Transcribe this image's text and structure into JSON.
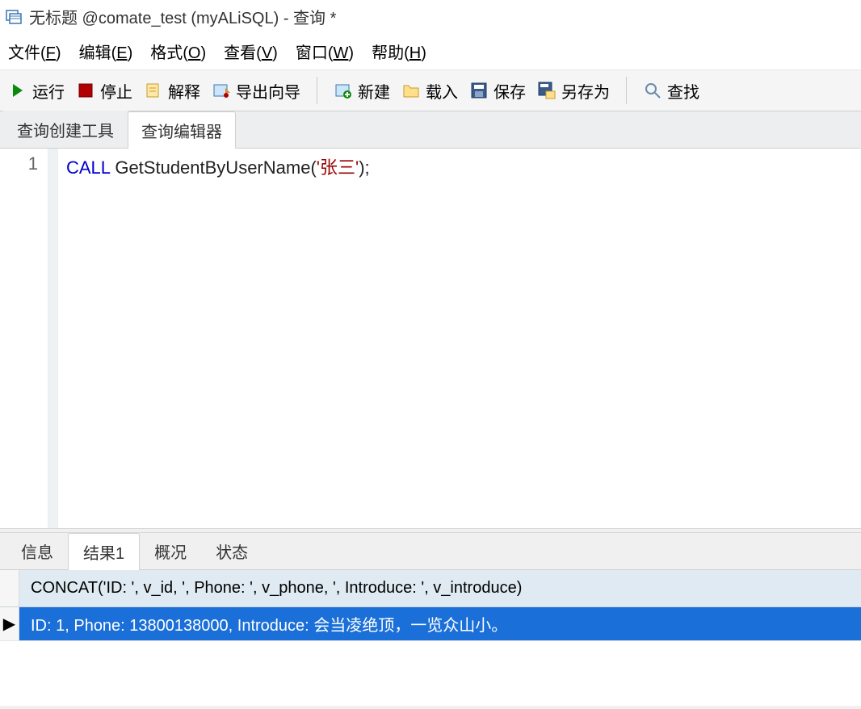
{
  "window": {
    "title": "无标题 @comate_test (myALiSQL) - 查询 *"
  },
  "menubar": {
    "file": "文件",
    "file_key": "F",
    "edit": "编辑",
    "edit_key": "E",
    "format": "格式",
    "format_key": "O",
    "view": "查看",
    "view_key": "V",
    "window": "窗口",
    "window_key": "W",
    "help": "帮助",
    "help_key": "H"
  },
  "toolbar": {
    "run": "运行",
    "stop": "停止",
    "explain": "解释",
    "export_wizard": "导出向导",
    "new": "新建",
    "load": "载入",
    "save": "保存",
    "save_as": "另存为",
    "find": "查找"
  },
  "editor_tabs": {
    "builder": "查询创建工具",
    "editor": "查询编辑器"
  },
  "code": {
    "line_no": "1",
    "keyword": "CALL",
    "func": " GetStudentByUserName(",
    "quote1": "'",
    "arg": "张三",
    "quote2": "'",
    "tail": ");"
  },
  "result_tabs": {
    "info": "信息",
    "result1": "结果1",
    "profile": "概况",
    "status": "状态"
  },
  "result": {
    "header": "CONCAT('ID: ', v_id, ', Phone: ', v_phone, ', Introduce: ', v_introduce)",
    "row1": "ID: 1, Phone: 13800138000, Introduce: 会当凌绝顶，一览众山小。"
  }
}
